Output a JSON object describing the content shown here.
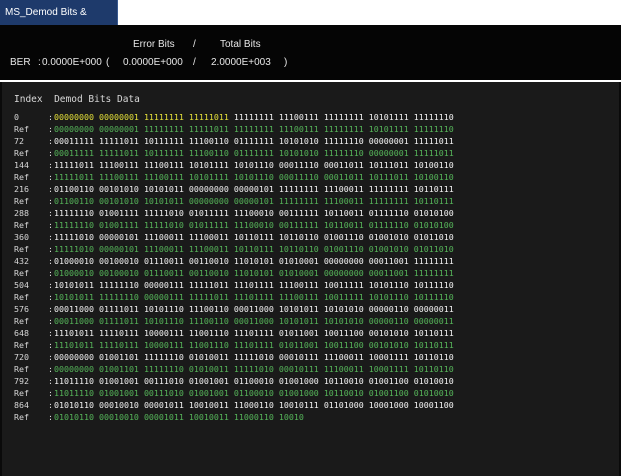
{
  "window": {
    "tab_label": "MS_Demod Bits & BER",
    "tab_caret": "▼"
  },
  "ber": {
    "header_error": "Error Bits",
    "header_slash": "/",
    "header_total": "Total Bits",
    "label": "BER",
    "colon": ":",
    "value": "0.0000E+000",
    "open_paren": "(",
    "error_bits": "0.0000E+000",
    "slash": "/",
    "total_bits": "2.0000E+003",
    "close_paren": ")"
  },
  "demod": {
    "index_header": "Index",
    "data_header": "Demod Bits Data",
    "rows": [
      {
        "kind": "data",
        "idx": "0",
        "bits": [
          "00000000",
          "00000001",
          "11111111",
          "11111011",
          "11111111",
          "11100111",
          "11111111",
          "10101111",
          "11111110"
        ],
        "hi": [
          0,
          1,
          2,
          3
        ]
      },
      {
        "kind": "ref",
        "idx": "Ref",
        "bits": [
          "00000000",
          "00000001",
          "11111111",
          "11111011",
          "11111111",
          "11100111",
          "11111111",
          "10101111",
          "11111110"
        ],
        "hi": []
      },
      {
        "kind": "data",
        "idx": "72",
        "bits": [
          "00011111",
          "11111011",
          "10111111",
          "11100110",
          "01111111",
          "10101010",
          "11111110",
          "00000001",
          "11111011"
        ],
        "hi": []
      },
      {
        "kind": "ref",
        "idx": "Ref",
        "bits": [
          "00011111",
          "11111011",
          "10111111",
          "11100110",
          "01111111",
          "10101010",
          "11111110",
          "00000001",
          "11111011"
        ],
        "hi": []
      },
      {
        "kind": "data",
        "idx": "144",
        "bits": [
          "11111011",
          "11100111",
          "11100111",
          "10101111",
          "10101110",
          "00011110",
          "00011011",
          "10111011",
          "10100110"
        ],
        "hi": []
      },
      {
        "kind": "ref",
        "idx": "Ref",
        "bits": [
          "11111011",
          "11100111",
          "11100111",
          "10101111",
          "10101110",
          "00011110",
          "00011011",
          "10111011",
          "10100110"
        ],
        "hi": []
      },
      {
        "kind": "data",
        "idx": "216",
        "bits": [
          "01100110",
          "00101010",
          "10101011",
          "00000000",
          "00000101",
          "11111111",
          "11100011",
          "11111111",
          "10110111"
        ],
        "hi": []
      },
      {
        "kind": "ref",
        "idx": "Ref",
        "bits": [
          "01100110",
          "00101010",
          "10101011",
          "00000000",
          "00000101",
          "11111111",
          "11100011",
          "11111111",
          "10110111"
        ],
        "hi": []
      },
      {
        "kind": "data",
        "idx": "288",
        "bits": [
          "11111110",
          "01001111",
          "11111010",
          "01011111",
          "11100010",
          "00111111",
          "10110011",
          "01111110",
          "01010100"
        ],
        "hi": []
      },
      {
        "kind": "ref",
        "idx": "Ref",
        "bits": [
          "11111110",
          "01001111",
          "11111010",
          "01011111",
          "11100010",
          "00111111",
          "10110011",
          "01111110",
          "01010100"
        ],
        "hi": []
      },
      {
        "kind": "data",
        "idx": "360",
        "bits": [
          "11111010",
          "00000101",
          "11100011",
          "11100011",
          "10110111",
          "10110110",
          "01001110",
          "01001010",
          "01011010"
        ],
        "hi": []
      },
      {
        "kind": "ref",
        "idx": "Ref",
        "bits": [
          "11111010",
          "00000101",
          "11100011",
          "11100011",
          "10110111",
          "10110110",
          "01001110",
          "01001010",
          "01011010"
        ],
        "hi": []
      },
      {
        "kind": "data",
        "idx": "432",
        "bits": [
          "01000010",
          "00100010",
          "01110011",
          "00110010",
          "11010101",
          "01010001",
          "00000000",
          "00011001",
          "11111111"
        ],
        "hi": []
      },
      {
        "kind": "ref",
        "idx": "Ref",
        "bits": [
          "01000010",
          "00100010",
          "01110011",
          "00110010",
          "11010101",
          "01010001",
          "00000000",
          "00011001",
          "11111111"
        ],
        "hi": []
      },
      {
        "kind": "data",
        "idx": "504",
        "bits": [
          "10101011",
          "11111110",
          "00000111",
          "11111011",
          "11101111",
          "11100111",
          "10011111",
          "10101110",
          "10111110"
        ],
        "hi": []
      },
      {
        "kind": "ref",
        "idx": "Ref",
        "bits": [
          "10101011",
          "11111110",
          "00000111",
          "11111011",
          "11101111",
          "11100111",
          "10011111",
          "10101110",
          "10111110"
        ],
        "hi": []
      },
      {
        "kind": "data",
        "idx": "576",
        "bits": [
          "00011000",
          "01111011",
          "10101110",
          "11100110",
          "00011000",
          "10101011",
          "10101010",
          "00000110",
          "00000011"
        ],
        "hi": []
      },
      {
        "kind": "ref",
        "idx": "Ref",
        "bits": [
          "00011000",
          "01111011",
          "10101110",
          "11100110",
          "00011000",
          "10101011",
          "10101010",
          "00000110",
          "00000011"
        ],
        "hi": []
      },
      {
        "kind": "data",
        "idx": "648",
        "bits": [
          "11101011",
          "11110111",
          "10000111",
          "11001110",
          "11101111",
          "01011001",
          "10011100",
          "00101010",
          "10110111"
        ],
        "hi": []
      },
      {
        "kind": "ref",
        "idx": "Ref",
        "bits": [
          "11101011",
          "11110111",
          "10000111",
          "11001110",
          "11101111",
          "01011001",
          "10011100",
          "00101010",
          "10110111"
        ],
        "hi": []
      },
      {
        "kind": "data",
        "idx": "720",
        "bits": [
          "00000000",
          "01001101",
          "11111110",
          "01010011",
          "11111010",
          "00010111",
          "11100011",
          "10001111",
          "10110110"
        ],
        "hi": []
      },
      {
        "kind": "ref",
        "idx": "Ref",
        "bits": [
          "00000000",
          "01001101",
          "11111110",
          "01010011",
          "11111010",
          "00010111",
          "11100011",
          "10001111",
          "10110110"
        ],
        "hi": []
      },
      {
        "kind": "data",
        "idx": "792",
        "bits": [
          "11011110",
          "01001001",
          "00111010",
          "01001001",
          "01100010",
          "01001000",
          "10110010",
          "01001100",
          "01010010"
        ],
        "hi": []
      },
      {
        "kind": "ref",
        "idx": "Ref",
        "bits": [
          "11011110",
          "01001001",
          "00111010",
          "01001001",
          "01100010",
          "01001000",
          "10110010",
          "01001100",
          "01010010"
        ],
        "hi": []
      },
      {
        "kind": "data",
        "idx": "864",
        "bits": [
          "01010110",
          "00010010",
          "00001011",
          "10010011",
          "11000110",
          "10010111",
          "01101000",
          "10001000",
          "10001100"
        ],
        "hi": []
      },
      {
        "kind": "ref",
        "idx": "Ref",
        "bits": [
          "01010110",
          "00010010",
          "00001011",
          "10010011",
          "11000110",
          "10010",
          "",
          "",
          ""
        ],
        "hi": []
      }
    ]
  }
}
